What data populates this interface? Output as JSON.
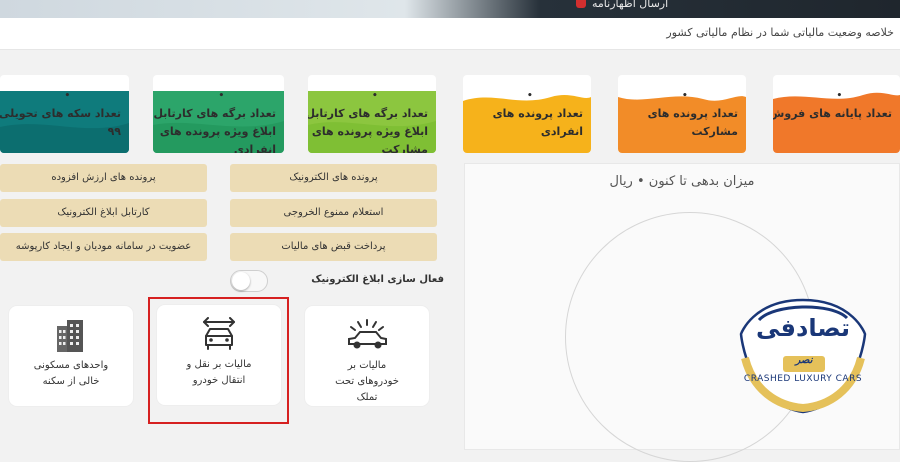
{
  "header": {
    "fragment_text": "ارسال اظهارنامه",
    "summary": "خلاصه وضعیت مالیاتی شما در نظام مالیاتی کشور"
  },
  "cards": [
    {
      "label": "تعداد پایانه های فروش",
      "value": "•",
      "color": "#f0782a"
    },
    {
      "label": "تعداد پرونده های مشارکت",
      "value": "•",
      "color": "#f28c28"
    },
    {
      "label": "تعداد پرونده های انفرادی",
      "value": "•",
      "color": "#f6b21b"
    },
    {
      "label": "تعداد برگه های کارتابل ابلاغ ویژه پرونده های مشارکت",
      "value": "•",
      "color": "#8cc63f"
    },
    {
      "label": "تعداد برگه های کارتابل ابلاغ ویژه پرونده های انفرادی",
      "value": "•",
      "color": "#2ca56a"
    },
    {
      "label": "تعداد سکه های تحویلی",
      "value": "•",
      "extra": "۹۹",
      "color": "#0f7b7c"
    }
  ],
  "buttons": {
    "electronic_files": "پرونده های الکترونیک",
    "vat_files": "پرونده های ارزش افزوده",
    "exit_ban": "استعلام ممنوع الخروجی",
    "electronic_notice": "کارتابل ابلاغ الکترونیک",
    "tax_payment": "پرداخت قبض های مالیات",
    "membership": "عضویت در سامانه مودیان و ایجاد کارپوشه"
  },
  "toggle": {
    "label": "فعال سازی ابلاغ الکترونیک",
    "on": false
  },
  "tiles": {
    "owned_vehicles": {
      "line1": "مالیات بر",
      "line2": "خودروهای تحت",
      "line3": "تملک"
    },
    "vehicle_transfer": {
      "line1": "مالیات بر نقل و",
      "line2": "انتقال خودرو"
    },
    "vacant_units": {
      "line1": "واحدهای مسکونی",
      "line2": "خالی از سکنه"
    }
  },
  "debt_panel": {
    "title": "میزان بدهی تا کنون • ریال"
  },
  "logo": {
    "wordmark": "تصادفی",
    "tagline": "نصر",
    "subtitle": "CRASHED LUXURY CARS",
    "color": "#1a3778"
  }
}
